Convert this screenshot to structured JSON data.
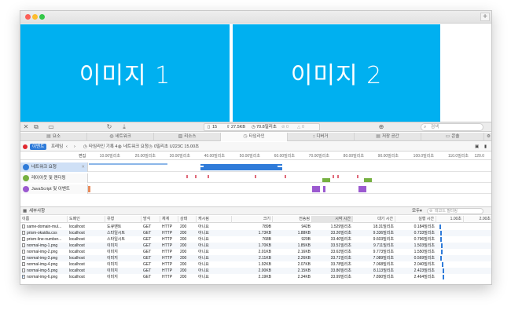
{
  "window": {
    "new_tab_label": "+"
  },
  "content": {
    "panel1": "이미지 1",
    "panel2": "이미지 2"
  },
  "addressbar": {
    "requests": "15",
    "size": "27.5KB",
    "time": "70.8밀리초",
    "errors": "0",
    "warnings": "0"
  },
  "search": {
    "placeholder": "검색"
  },
  "tabs": [
    "요소",
    "네트워크",
    "리소스",
    "타임라인",
    "디버거",
    "저장 공간",
    "콘솔"
  ],
  "timeline_toolbar": {
    "events_label": "이벤트",
    "frames_label": "프레임",
    "record_label": "타임라인 기록 4",
    "target_label": "네트워크 요청",
    "summary_label": "0밀리초 U223C 15.00초"
  },
  "ruler": {
    "edit_label": "편집",
    "ticks": [
      "10.00밀리초",
      "20.00밀리초",
      "30.00밀리초",
      "40.00밀리초",
      "50.00밀리초",
      "60.00밀리초",
      "70.00밀리초",
      "80.00밀리초",
      "90.00밀리초",
      "100.0밀리초",
      "110.0밀리초",
      "120.0"
    ]
  },
  "tracks": [
    {
      "label": "네트워크 요청",
      "icon": "network-icon",
      "color": "#2f7bd9",
      "close": "✕"
    },
    {
      "label": "레이아웃 및 렌더링",
      "icon": "layout-icon",
      "color": "#76b041",
      "close": ""
    },
    {
      "label": "JavaScript 및 이벤트",
      "icon": "script-icon",
      "color": "#9b59d0",
      "close": ""
    }
  ],
  "details": {
    "title": "세부사항",
    "all_label": "모두",
    "filter_placeholder": "레코드 필터링"
  },
  "table": {
    "columns": [
      "이름",
      "도메인",
      "유형",
      "방식",
      "체계",
      "상태",
      "캐시됨",
      "크기",
      "전송됨",
      "시작 시간",
      "대기 시간",
      "실행 시간",
      "1.00초",
      "2.00초"
    ],
    "rows": [
      [
        "same-domain-mul...",
        "localhost",
        "도큐멘트",
        "GET",
        "HTTP",
        "200",
        "아니요",
        "789B",
        "942B",
        "1.529밀리초",
        "18.31밀리초",
        "0.184밀리초"
      ],
      [
        "prism-okaidia.css",
        "localhost",
        "스타일시트",
        "GET",
        "HTTP",
        "200",
        "아니요",
        "1.73KB",
        "1.88KB",
        "33.26밀리초",
        "9.336밀리초",
        "0.733밀리초"
      ],
      [
        "prism-line-number...",
        "localhost",
        "스타일시트",
        "GET",
        "HTTP",
        "200",
        "아니요",
        "768B",
        "920B",
        "33.40밀리초",
        "9.603밀리초",
        "0.796밀리초"
      ],
      [
        "normal-img-1.png",
        "localhost",
        "이미지",
        "GET",
        "HTTP",
        "200",
        "아니요",
        "1.70KB",
        "1.85KB",
        "33.51밀리초",
        "9.711밀리초",
        "1.503밀리초"
      ],
      [
        "normal-img-2.png",
        "localhost",
        "이미지",
        "GET",
        "HTTP",
        "200",
        "아니요",
        "2.01KB",
        "2.16KB",
        "33.63밀리초",
        "9.773밀리초",
        "1.550밀리초"
      ],
      [
        "normal-img-3.png",
        "localhost",
        "이미지",
        "GET",
        "HTTP",
        "200",
        "아니요",
        "2.11KB",
        "2.26KB",
        "33.71밀리초",
        "7.089밀리초",
        "0.569밀리초"
      ],
      [
        "normal-img-4.png",
        "localhost",
        "이미지",
        "GET",
        "HTTP",
        "200",
        "아니요",
        "1.92KB",
        "2.07KB",
        "33.78밀리초",
        "7.068밀리초",
        "2.040밀리초"
      ],
      [
        "normal-img-5.png",
        "localhost",
        "이미지",
        "GET",
        "HTTP",
        "200",
        "아니요",
        "2.00KB",
        "2.15KB",
        "33.86밀리초",
        "8.113밀리초",
        "2.423밀리초"
      ],
      [
        "normal-img-6.png",
        "localhost",
        "이미지",
        "GET",
        "HTTP",
        "200",
        "아니요",
        "2.19KB",
        "2.34KB",
        "33.99밀리초",
        "7.890밀리초",
        "2.464밀리초"
      ]
    ]
  },
  "console": {
    "prompt": "›"
  },
  "colors": {
    "accent": "#2f7bd9",
    "panel": "#00b0f0",
    "layout": "#76b041",
    "script": "#9b59d0",
    "paint": "#e06a7a"
  }
}
